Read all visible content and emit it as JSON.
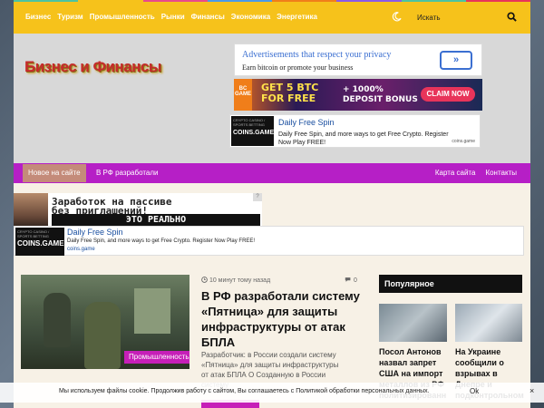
{
  "topnav": {
    "items": [
      "Бизнес",
      "Туризм",
      "Промышленность",
      "Рынки",
      "Финансы",
      "Экономика",
      "Энергетика"
    ],
    "search_placeholder": "Искать",
    "colorbar": [
      "#4cc3a0",
      "#f6c21b",
      "#e84a8a",
      "#4a9ae8",
      "#f07e1a",
      "#8a5ae8",
      "#4cc3a0",
      "#e8345a"
    ]
  },
  "header": {
    "logo": "Бизнес и Финансы"
  },
  "ads": {
    "privacy": {
      "title": "Advertisements that respect your privacy",
      "subtitle": "Earn bitcoin or promote your business",
      "button": "»"
    },
    "bcgame": {
      "brand": "BC GAME",
      "headline_1": "GET 5 BTC",
      "headline_2": "FOR FREE",
      "bonus_1": "+ 1000%",
      "bonus_2": "DEPOSIT BONUS",
      "cta": "CLAIM NOW"
    },
    "coins_header": {
      "logo_small": "CRYPTO CASINO / SPORTS BETTING",
      "logo_big": "COINS.GAME",
      "title": "Daily Free Spin",
      "text": "Daily Free Spin, and more ways to get Free Crypto. Register Now Play FREE!",
      "source": "coins.game"
    },
    "banner": {
      "line1": "Заработок на пассиве",
      "line2": "без приглашений!",
      "line3": "ЭТО РЕАЛЬНО",
      "badge": "?"
    },
    "coins_wide": {
      "logo_small": "CRYPTO CASINO / SPORTS BETTING",
      "logo_big": "COINS.GAME",
      "title": "Daily Free Spin",
      "text": "Daily Free Spin, and more ways to get Free Crypto. Register Now Play FREE!",
      "source": "coins.game"
    }
  },
  "mainnav": {
    "active": "Новое на сайте",
    "ticker": "В РФ разработали",
    "right": [
      "Карта сайта",
      "Контакты"
    ]
  },
  "article": {
    "category": "Промышленность",
    "time": "10 минут тому назад",
    "comments": "0",
    "title": "В РФ разработали систему «Пятница» для защиты инфраструктуры от атак БПЛА",
    "excerpt": "Разработчик: в России создали систему «Пятница» для защиты инфраструктуры от атак БПЛА О Созданную в России систему"
  },
  "sidebar": {
    "heading": "Популярное",
    "items": [
      "Посол Антонов назвал запрет США на импорт металлов из РФ политизированн",
      "На Украине сообщили о взрывах в Днепре и подконтрольном"
    ]
  },
  "cookie": {
    "text": "Мы используем файлы cookie. Продолжив работу с сайтом, Вы соглашаетесь с Политикой обработки персональных данных.",
    "ok": "Ok",
    "close": "×"
  }
}
